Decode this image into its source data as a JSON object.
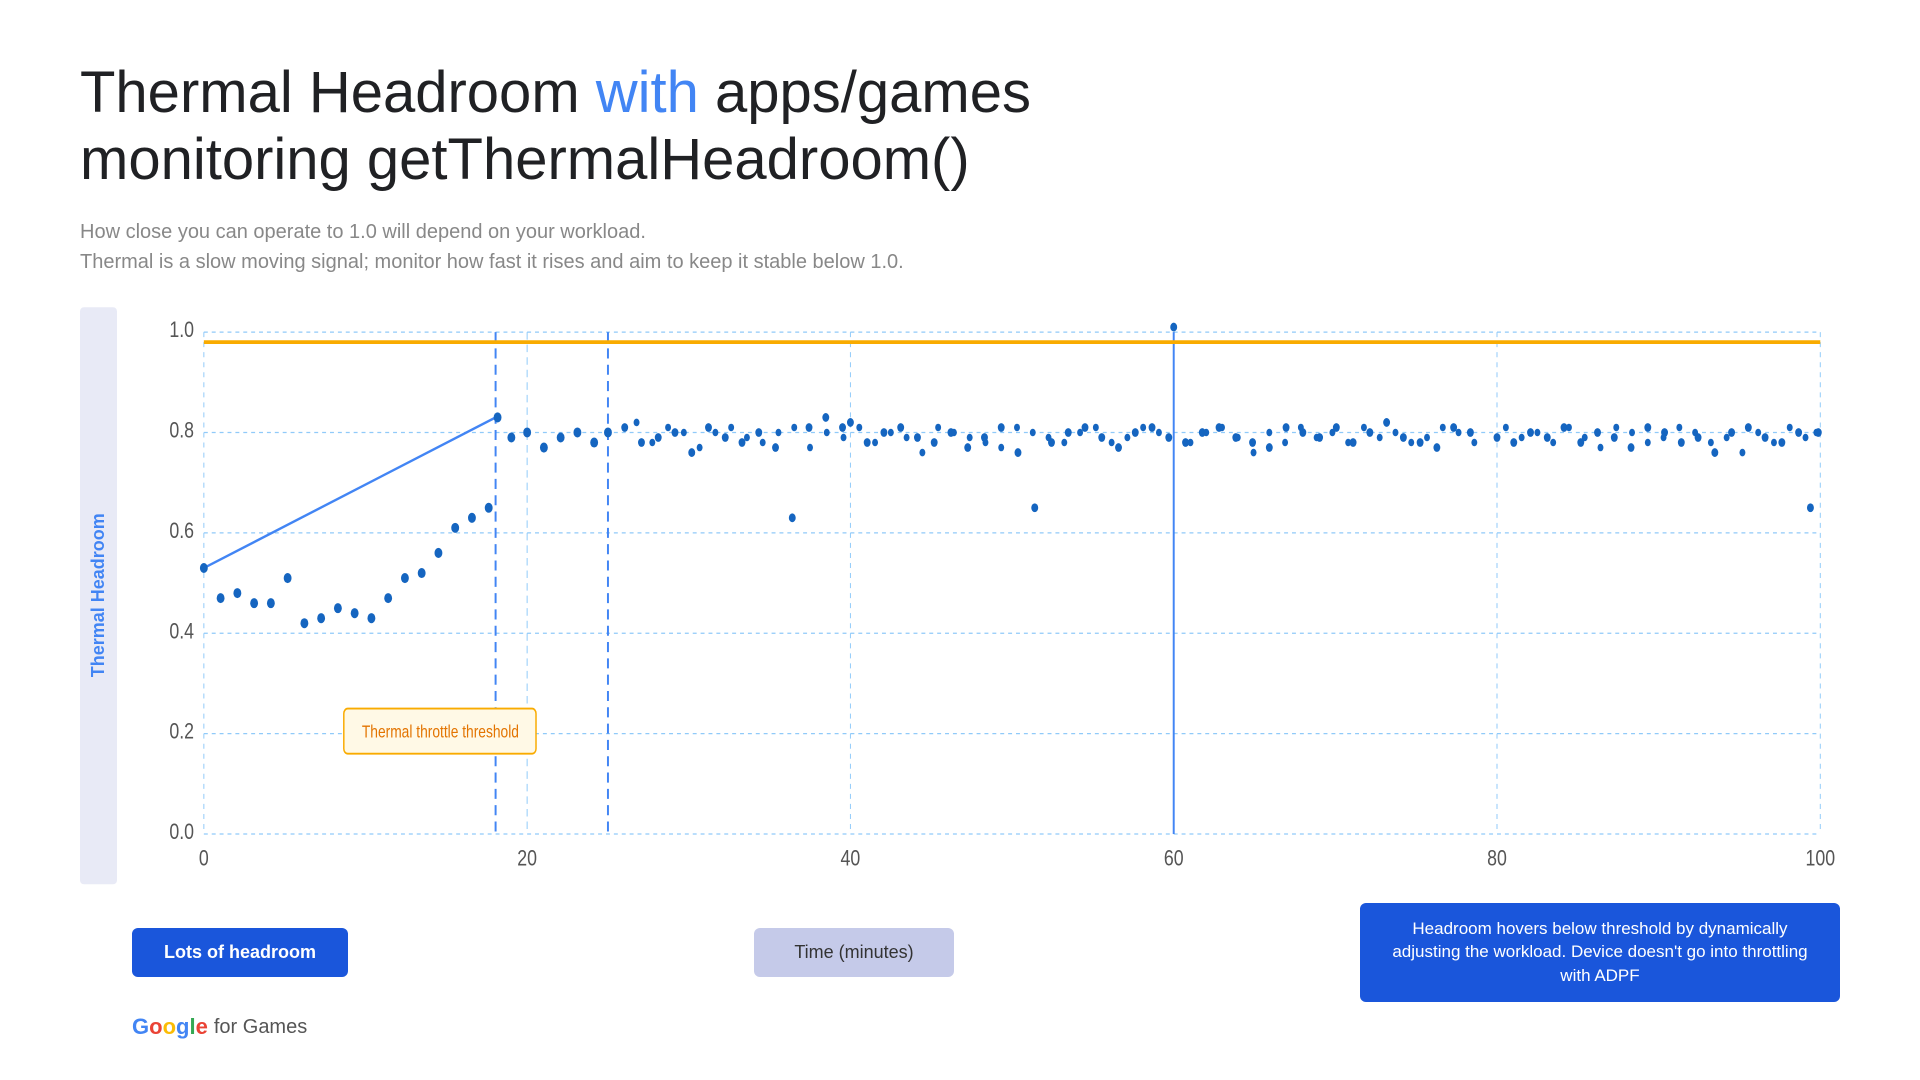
{
  "title": {
    "part1": "Thermal Headroom ",
    "highlight": "with",
    "part2": " apps/games",
    "line2": "monitoring getThermalHeadroom()"
  },
  "subtitle": {
    "line1": "How close you can operate to 1.0 will depend on your workload.",
    "line2": "Thermal is a slow moving signal; monitor how fast it rises and aim to keep it stable below 1.0."
  },
  "chart": {
    "y_label": "Thermal Headroom",
    "y_ticks": [
      "0.0",
      "0.2",
      "0.4",
      "0.6",
      "0.8",
      "1.0"
    ],
    "x_ticks": [
      "0",
      "20",
      "40",
      "60",
      "80",
      "100"
    ],
    "threshold_label": "Thermal throttle threshold",
    "threshold_value": 1.0,
    "colors": {
      "threshold_line": "#f9ab00",
      "grid_line": "#90CAF9",
      "dot_line": "#90CAF9",
      "vertical_solid": "#4285F4",
      "data_point": "#1565C0",
      "trend_line": "#4285F4"
    }
  },
  "buttons": {
    "lots_headroom": "Lots of headroom",
    "time_minutes": "Time (minutes)",
    "headroom_desc": "Headroom hovers below threshold by dynamically adjusting the workload. Device doesn't go into throttling with ADPF"
  },
  "google_logo": {
    "google": "Google",
    "for_games": " for Games"
  }
}
